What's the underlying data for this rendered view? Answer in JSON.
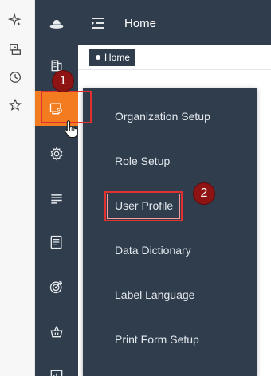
{
  "header": {
    "title": "Home"
  },
  "breadcrumb": {
    "label": "Home"
  },
  "flyout": {
    "items": [
      "Organization Setup",
      "Role Setup",
      "User Profile",
      "Data Dictionary",
      "Label Language",
      "Print Form Setup"
    ]
  },
  "annotations": {
    "step1": "1",
    "step2": "2"
  },
  "colors": {
    "sidebar": "#2f3d4d",
    "active": "#f47c20",
    "highlight": "#e03030",
    "badge": "#8e1414"
  },
  "icons": {
    "strip": [
      "sparkle-icon",
      "tab-export-icon",
      "history-icon",
      "favorites-icon"
    ],
    "sidebar": [
      "logo-icon",
      "building-icon",
      "settings-dashboard-icon",
      "gear-icon",
      "list-icon",
      "form-icon",
      "target-icon",
      "basket-icon",
      "chart-icon"
    ]
  }
}
